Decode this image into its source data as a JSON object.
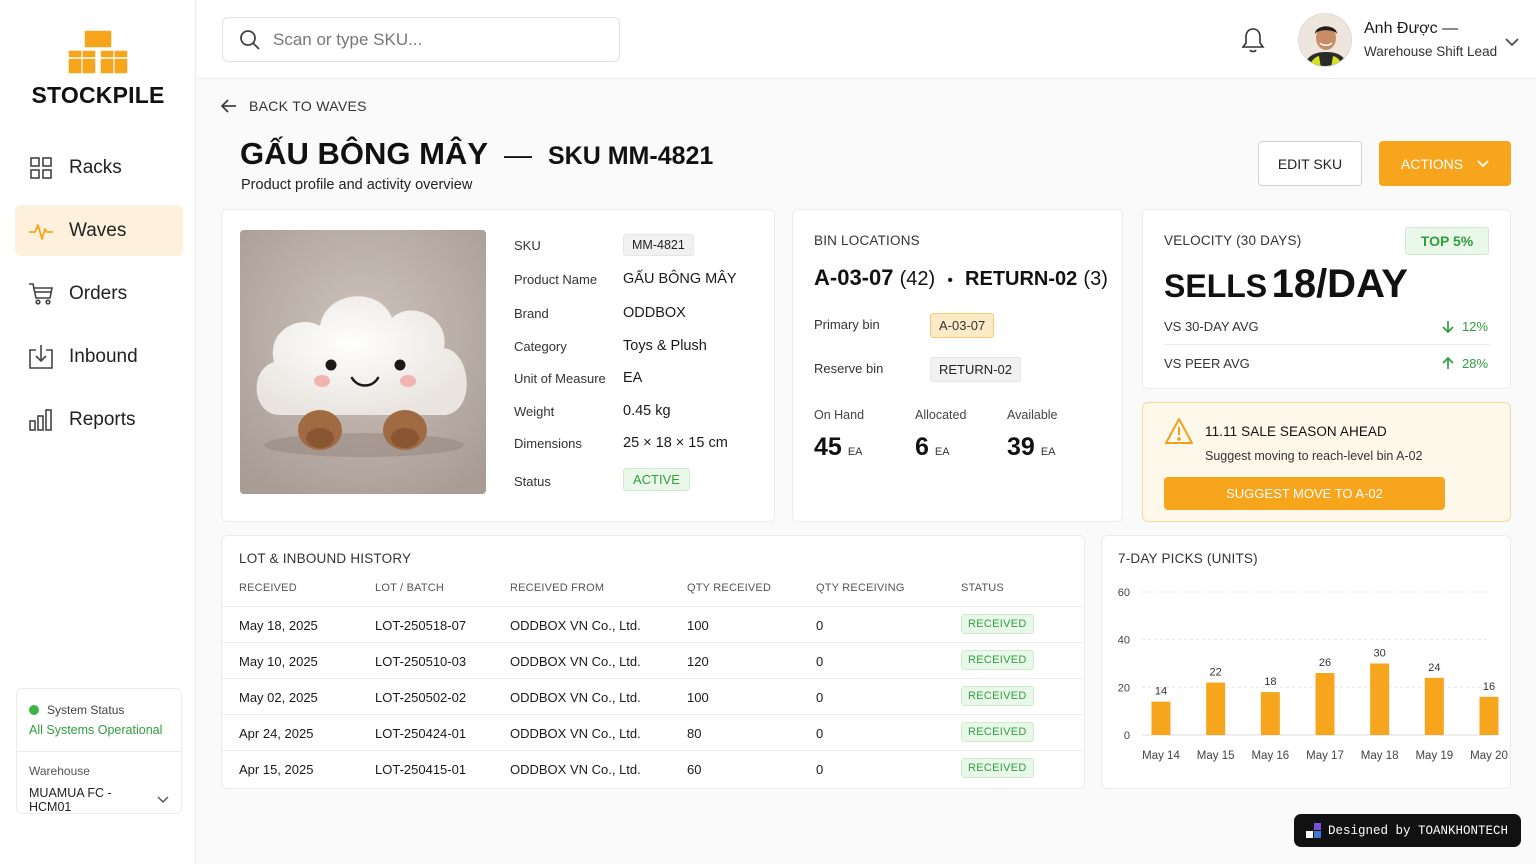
{
  "app": {
    "name": "STOCKPILE"
  },
  "sidebar": {
    "items": [
      {
        "label": "Racks",
        "icon": "grid-icon",
        "active": false
      },
      {
        "label": "Waves",
        "icon": "pulse-icon",
        "active": true
      },
      {
        "label": "Orders",
        "icon": "cart-icon",
        "active": false
      },
      {
        "label": "Inbound",
        "icon": "inbound-icon",
        "active": false
      },
      {
        "label": "Reports",
        "icon": "bar-chart-icon",
        "active": false
      }
    ],
    "system_status_label": "System Status",
    "system_status_value": "All Systems Operational",
    "warehouse_label": "Warehouse",
    "warehouse_value": "MUAMUA FC - HCM01"
  },
  "topbar": {
    "search_placeholder": "Scan or type SKU...",
    "user_name": "Anh Được —",
    "user_role": "Warehouse Shift Lead"
  },
  "header": {
    "back_label": "BACK TO WAVES",
    "product_name": "GẤU BÔNG MÂY",
    "dash": "—",
    "sku_label": "SKU MM-4821",
    "subtitle": "Product profile and activity overview",
    "edit_label": "EDIT SKU",
    "actions_label": "ACTIONS"
  },
  "product": {
    "attributes": [
      {
        "label": "SKU",
        "value": "MM-4821"
      },
      {
        "label": "Product Name",
        "value": "GẤU BÔNG MÂY"
      },
      {
        "label": "Brand",
        "value": "ODDBOX"
      },
      {
        "label": "Category",
        "value": "Toys & Plush"
      },
      {
        "label": "Unit of Measure",
        "value": "EA"
      },
      {
        "label": "Weight",
        "value": "0.45 kg"
      },
      {
        "label": "Dimensions",
        "value": "25 × 18 × 15 cm"
      },
      {
        "label": "Status",
        "value": "ACTIVE"
      }
    ]
  },
  "bins": {
    "title": "BIN LOCATIONS",
    "primary_code": "A-03-07",
    "primary_qty": "(42)",
    "separator": "•",
    "reserve_code": "RETURN-02",
    "reserve_qty": "(3)",
    "primary_label": "Primary bin",
    "primary_value": "A-03-07",
    "reserve_label": "Reserve bin",
    "reserve_value": "RETURN-02",
    "on_hand_label": "On Hand",
    "on_hand_value": "45",
    "allocated_label": "Allocated",
    "allocated_value": "6",
    "available_label": "Available",
    "available_value": "39",
    "unit": "EA"
  },
  "velocity": {
    "title": "VELOCITY (30 DAYS)",
    "badge": "TOP 5%",
    "big_prefix": "SELLS",
    "big_value": "18/DAY",
    "rows": [
      {
        "label": "VS 30-DAY AVG",
        "value": "12%",
        "direction": "down"
      },
      {
        "label": "VS PEER AVG",
        "value": "28%",
        "direction": "up"
      }
    ]
  },
  "alert": {
    "title": "11.11 SALE SEASON AHEAD",
    "text": "Suggest moving to reach-level bin A-02",
    "button": "SUGGEST MOVE TO A-02"
  },
  "history": {
    "title": "LOT & INBOUND HISTORY",
    "columns": [
      "RECEIVED",
      "LOT / BATCH",
      "RECEIVED FROM",
      "QTY RECEIVED",
      "QTY RECEIVING",
      "STATUS"
    ],
    "rows": [
      [
        "May 18, 2025",
        "LOT-250518-07",
        "ODDBOX VN Co., Ltd.",
        "100",
        "0",
        "RECEIVED"
      ],
      [
        "May 10, 2025",
        "LOT-250510-03",
        "ODDBOX VN Co., Ltd.",
        "120",
        "0",
        "RECEIVED"
      ],
      [
        "May 02, 2025",
        "LOT-250502-02",
        "ODDBOX VN Co., Ltd.",
        "100",
        "0",
        "RECEIVED"
      ],
      [
        "Apr 24, 2025",
        "LOT-250424-01",
        "ODDBOX VN Co., Ltd.",
        "80",
        "0",
        "RECEIVED"
      ],
      [
        "Apr 15, 2025",
        "LOT-250415-01",
        "ODDBOX VN Co., Ltd.",
        "60",
        "0",
        "RECEIVED"
      ]
    ]
  },
  "chart_data": {
    "type": "bar",
    "title": "7-DAY PICKS (UNITS)",
    "categories": [
      "May 14",
      "May 15",
      "May 16",
      "May 17",
      "May 18",
      "May 19",
      "May 20"
    ],
    "values": [
      14,
      22,
      18,
      26,
      30,
      24,
      16
    ],
    "yticks": [
      0,
      20,
      40,
      60
    ],
    "ylim": [
      0,
      60
    ],
    "grid": true,
    "bar_color": "#f7a51c"
  },
  "credit": {
    "text": "Designed by TOANKHONTECH"
  },
  "colors": {
    "accent": "#f7a51c",
    "success": "#2e9e3e",
    "active_bg": "#fdf0dc"
  }
}
